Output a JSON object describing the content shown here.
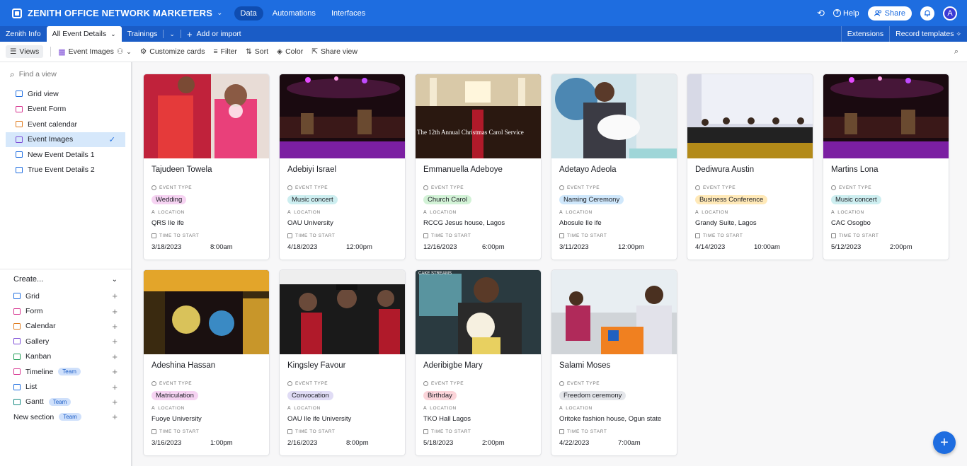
{
  "header": {
    "base_name": "ZENITH OFFICE NETWORK MARKETERS",
    "tabs": [
      "Data",
      "Automations",
      "Interfaces"
    ],
    "help_label": "Help",
    "share_label": "Share",
    "avatar_letter": "A",
    "accent_color": "#1e6de0"
  },
  "tables": {
    "items": [
      "Zenith Info",
      "All Event Details",
      "Trainings"
    ],
    "add_label": "Add or import",
    "extensions_label": "Extensions",
    "record_templates_label": "Record templates"
  },
  "toolbar": {
    "views_label": "Views",
    "current_view": "Event Images",
    "customize_label": "Customize cards",
    "filter_label": "Filter",
    "sort_label": "Sort",
    "color_label": "Color",
    "share_view_label": "Share view"
  },
  "sidebar": {
    "find_placeholder": "Find a view",
    "views": [
      {
        "label": "Grid view",
        "icon": "grid-icon",
        "color": "#1e6de0"
      },
      {
        "label": "Event Form",
        "icon": "form-icon",
        "color": "#d6338f"
      },
      {
        "label": "Event calendar",
        "icon": "calendar-icon",
        "color": "#e07b1e"
      },
      {
        "label": "Event Images",
        "icon": "gallery-icon",
        "color": "#7c4bd6"
      },
      {
        "label": "New Event Details 1",
        "icon": "grid-icon",
        "color": "#1e6de0"
      },
      {
        "label": "True Event Details 2",
        "icon": "grid-icon",
        "color": "#1e6de0"
      }
    ],
    "create_label": "Create...",
    "create_items": [
      {
        "label": "Grid",
        "color": "#1e6de0",
        "badge": ""
      },
      {
        "label": "Form",
        "color": "#d6338f",
        "badge": ""
      },
      {
        "label": "Calendar",
        "color": "#e07b1e",
        "badge": ""
      },
      {
        "label": "Gallery",
        "color": "#7c4bd6",
        "badge": ""
      },
      {
        "label": "Kanban",
        "color": "#1f9d55",
        "badge": ""
      },
      {
        "label": "Timeline",
        "color": "#d6338f",
        "badge": "Team"
      },
      {
        "label": "List",
        "color": "#1e6de0",
        "badge": ""
      },
      {
        "label": "Gantt",
        "color": "#12877f",
        "badge": "Team"
      },
      {
        "label": "New section",
        "color": "",
        "badge": "Team"
      }
    ]
  },
  "field_labels": {
    "event_type": "EVENT TYPE",
    "location": "LOCATION",
    "time_to_start": "TIME TO START"
  },
  "cards": [
    {
      "name": "Tajudeen Towela",
      "event_type": "Wedding",
      "pill_bg": "#f6d3f2",
      "location": "QRS Ile ife",
      "date": "3/18/2023",
      "time": "8:00am",
      "img": "img-a"
    },
    {
      "name": "Adebiyi Israel",
      "event_type": "Music concert",
      "pill_bg": "#cdeef0",
      "location": "OAU University",
      "date": "4/18/2023",
      "time": "12:00pm",
      "img": "img-b"
    },
    {
      "name": "Emmanuella Adeboye",
      "event_type": "Church Carol",
      "pill_bg": "#d2f2d6",
      "location": "RCCG Jesus house, Lagos",
      "date": "12/16/2023",
      "time": "6:00pm",
      "img": "img-c"
    },
    {
      "name": "Adetayo Adeola",
      "event_type": "Naming Ceremony",
      "pill_bg": "#cfe7fb",
      "location": "Abosule Ile ife",
      "date": "3/11/2023",
      "time": "12:00pm",
      "img": "img-d"
    },
    {
      "name": "Dediwura Austin",
      "event_type": "Business Conference",
      "pill_bg": "#ffe9b8",
      "location": "Grandy Suite, Lagos",
      "date": "4/14/2023",
      "time": "10:00am",
      "img": "img-e"
    },
    {
      "name": "Martins Lona",
      "event_type": "Music concert",
      "pill_bg": "#cdeef0",
      "location": "CAC Osogbo",
      "date": "5/12/2023",
      "time": "2:00pm",
      "img": "img-b"
    },
    {
      "name": "Adeshina Hassan",
      "event_type": "Matriculation",
      "pill_bg": "#f6d3f2",
      "location": "Fuoye University",
      "date": "3/16/2023",
      "time": "1:00pm",
      "img": "img-f"
    },
    {
      "name": "Kingsley Favour",
      "event_type": "Convocation",
      "pill_bg": "#e0dcf5",
      "location": "OAU Ile ife University",
      "date": "2/16/2023",
      "time": "8:00pm",
      "img": "img-g"
    },
    {
      "name": "Aderibigbe Mary",
      "event_type": "Birthday",
      "pill_bg": "#fbd4d9",
      "location": "TKO Hall Lagos",
      "date": "5/18/2023",
      "time": "2:00pm",
      "img": "img-h"
    },
    {
      "name": "Salami Moses",
      "event_type": "Freedom ceremony",
      "pill_bg": "#e4e6ea",
      "location": "Oritoke fashion house, Ogun state",
      "date": "4/22/2023",
      "time": "7:00am",
      "img": "img-i"
    }
  ],
  "image_captions": {
    "carol": "The 12th Annual Christmas Carol Service",
    "bday": "CAKE STREAMS"
  }
}
